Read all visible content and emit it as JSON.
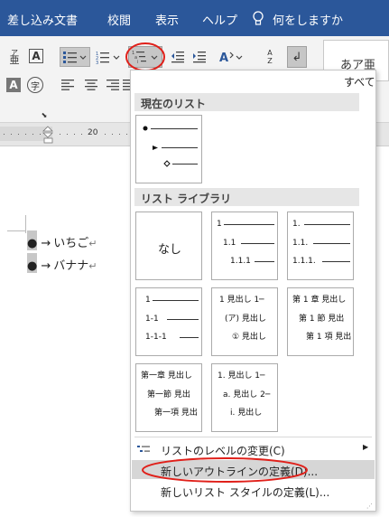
{
  "tabs": [
    "差し込み文書",
    "校閲",
    "表示",
    "ヘルプ",
    "何をしますか"
  ],
  "style_gallery_sample": "あア亜",
  "menu": {
    "all_label": "すべて",
    "current_list_header": "現在のリスト",
    "library_header": "リスト ライブラリ",
    "none_label": "なし",
    "library": {
      "numeric_1": [
        "1",
        "1.1",
        "1.1.1"
      ],
      "numeric_2": [
        "1.",
        "1.1.",
        "1.1.1."
      ],
      "dash_numeric": [
        "1",
        "1-1",
        "1-1-1"
      ],
      "heading_numeric": [
        "1 見出し 1─",
        "(ア) 見出し",
        "① 見出し"
      ],
      "chapter_numeric": [
        "第 1 章 見出し",
        "第 1 節 見出",
        "第 1 項 見出"
      ],
      "chapter_kanji": [
        "第一章 見出し",
        "第一節 見出",
        "第一項 見出"
      ],
      "heading_alpha": [
        "1. 見出し 1─",
        "a. 見出し 2─",
        "i. 見出し"
      ]
    },
    "items": [
      {
        "label": "リストのレベルの変更(C)",
        "has_arrow": true
      },
      {
        "label": "新しいアウトラインの定義(D)...",
        "highlighted": true
      },
      {
        "label": "新しいリスト スタイルの定義(L)..."
      }
    ]
  },
  "ruler": {
    "mark": "20"
  },
  "document": {
    "lines": [
      "いちご",
      "バナナ"
    ]
  },
  "colors": {
    "titlebar": "#2b579a",
    "highlight_ring": "#e0201a",
    "menu_hover": "#d6d6d6"
  }
}
